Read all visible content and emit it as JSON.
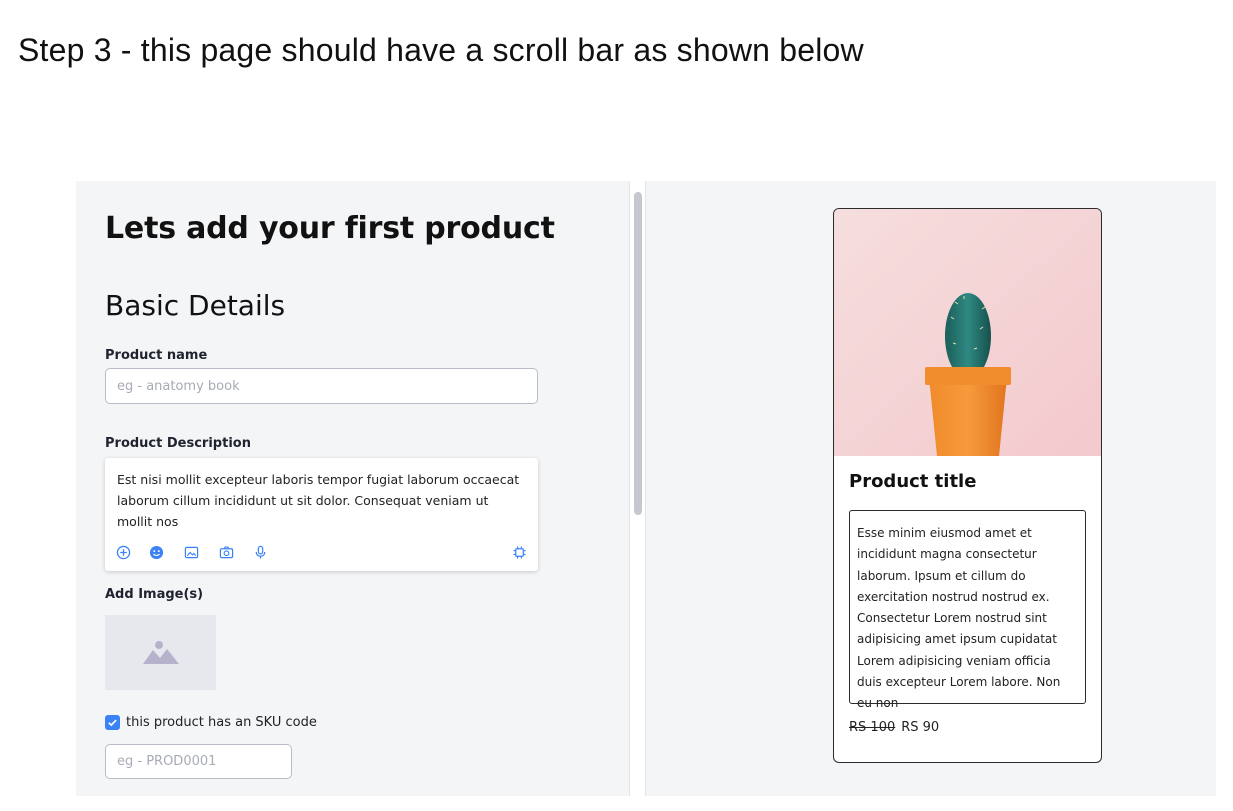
{
  "caption": "Step 3 - this page should have a scroll bar as shown below",
  "form": {
    "heading": "Lets add your first product",
    "section_title": "Basic Details",
    "product_name_label": "Product name",
    "product_name_placeholder": "eg - anatomy book",
    "product_description_label": "Product Description",
    "product_description_value": "Est nisi mollit excepteur laboris tempor fugiat laborum occaecat laborum cillum incididunt ut sit dolor. Consequat veniam ut mollit nos",
    "add_images_label": "Add Image(s)",
    "sku_checkbox_label": "this product has an SKU code",
    "sku_checkbox_checked": true,
    "sku_placeholder": "eg - PROD0001",
    "toolbar_icons": [
      "add-circle-icon",
      "emoji-icon",
      "image-icon",
      "camera-icon",
      "microphone-icon",
      "settings-icon"
    ]
  },
  "preview": {
    "title": "Product title",
    "description": "Esse minim eiusmod amet et incididunt magna consectetur laborum. Ipsum et cillum do exercitation nostrud nostrud ex. Consectetur Lorem nostrud sint adipisicing amet ipsum cupidatat Lorem adipisicing veniam officia duis excepteur Lorem labore. Non eu non",
    "old_price": "RS 100",
    "price": "RS 90",
    "image": "cactus-in-orange-pot"
  },
  "colors": {
    "accent": "#3b82f6",
    "panel_bg": "#f4f5f7",
    "scroll_thumb": "#c5c8cf"
  }
}
